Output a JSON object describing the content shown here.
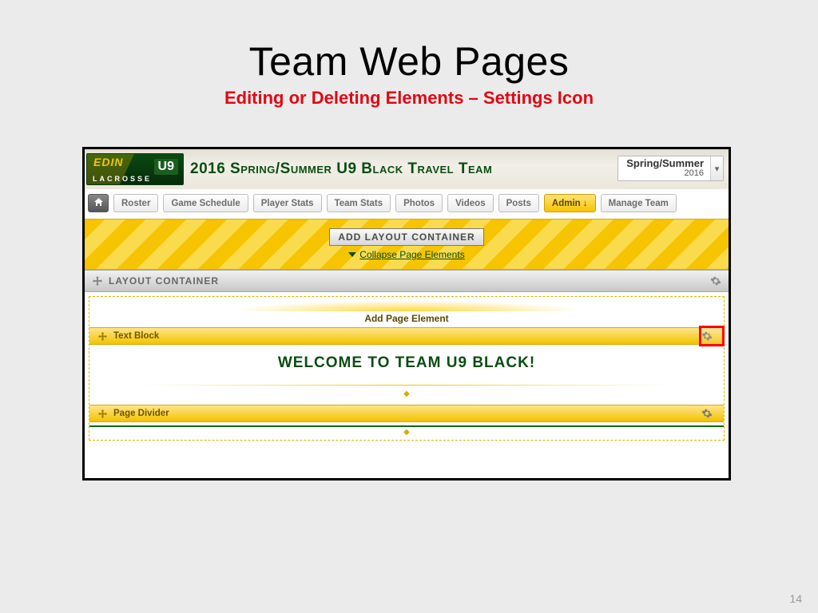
{
  "slide": {
    "title": "Team Web Pages",
    "subtitle": "Editing or Deleting Elements – Settings Icon",
    "page_number": "14"
  },
  "logo": {
    "line1": "EDIN",
    "badge": "U9",
    "line2": "LACROSSE"
  },
  "header": {
    "team_title": "2016 Spring/Summer U9 Black Travel Team"
  },
  "season": {
    "line1": "Spring/Summer",
    "line2": "2016"
  },
  "tabs": {
    "roster": "Roster",
    "schedule": "Game Schedule",
    "player_stats": "Player Stats",
    "team_stats": "Team Stats",
    "photos": "Photos",
    "videos": "Videos",
    "posts": "Posts",
    "admin": "Admin ↓",
    "manage": "Manage Team"
  },
  "band": {
    "add_layout": "ADD LAYOUT CONTAINER",
    "collapse": "Collapse Page Elements"
  },
  "layout_container_label": "LAYOUT CONTAINER",
  "add_page_element": "Add Page Element",
  "elements": {
    "text_block": "Text Block",
    "page_divider": "Page Divider"
  },
  "content": {
    "welcome": "WELCOME TO TEAM U9 BLACK!"
  }
}
